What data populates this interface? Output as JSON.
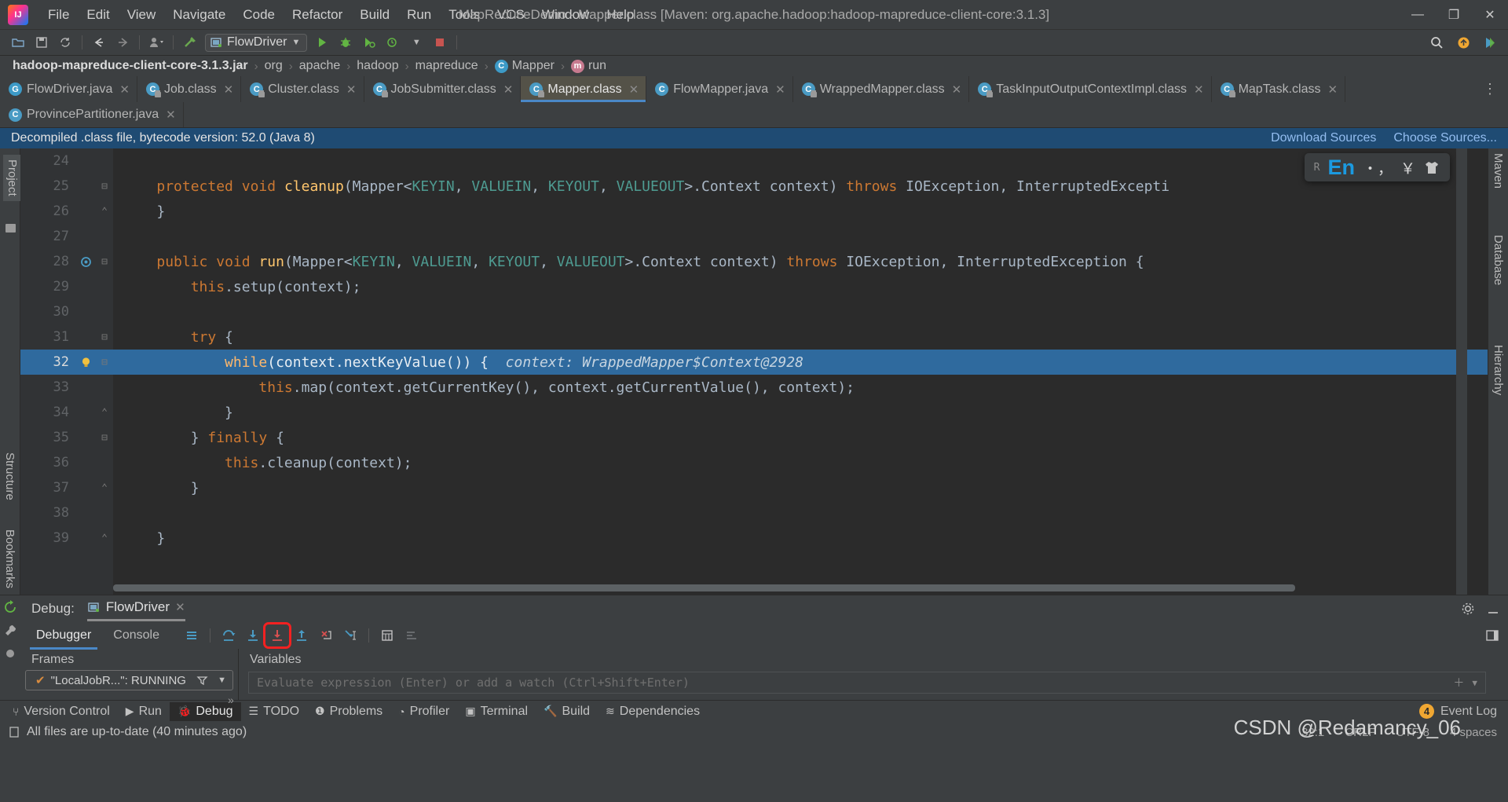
{
  "window": {
    "title": "MapReduceDemo - Mapper.class [Maven: org.apache.hadoop:hadoop-mapreduce-client-core:3.1.3]",
    "minimize": "—",
    "maximize": "❐",
    "close": "✕"
  },
  "menu": [
    "File",
    "Edit",
    "View",
    "Navigate",
    "Code",
    "Refactor",
    "Build",
    "Run",
    "Tools",
    "VCS",
    "Window",
    "Help"
  ],
  "toolbar": {
    "run_config": "FlowDriver",
    "icons": [
      "open-folder-icon",
      "save-icon",
      "sync-icon",
      "back-arrow-icon",
      "forward-arrow-icon",
      "profile-icon",
      "build-hammer-icon"
    ],
    "right_icons": [
      "search-icon",
      "account-icon",
      "updates-icon"
    ]
  },
  "breadcrumb": [
    {
      "label": "hadoop-mapreduce-client-core-3.1.3.jar",
      "icon": ""
    },
    {
      "label": "org",
      "icon": ""
    },
    {
      "label": "apache",
      "icon": ""
    },
    {
      "label": "hadoop",
      "icon": ""
    },
    {
      "label": "mapreduce",
      "icon": ""
    },
    {
      "label": "Mapper",
      "icon": "class-icon"
    },
    {
      "label": "run",
      "icon": "method-icon"
    }
  ],
  "tabs": [
    {
      "label": "FlowDriver.java",
      "icon": "java-run-icon",
      "active": false
    },
    {
      "label": "Job.class",
      "icon": "class-locked-icon",
      "active": false
    },
    {
      "label": "Cluster.class",
      "icon": "class-locked-icon",
      "active": false
    },
    {
      "label": "JobSubmitter.class",
      "icon": "class-locked-icon",
      "active": false
    },
    {
      "label": "Mapper.class",
      "icon": "class-locked-icon",
      "active": true
    },
    {
      "label": "FlowMapper.java",
      "icon": "class-icon",
      "active": false
    },
    {
      "label": "WrappedMapper.class",
      "icon": "class-locked-icon",
      "active": false
    },
    {
      "label": "TaskInputOutputContextImpl.class",
      "icon": "class-locked-icon",
      "active": false
    },
    {
      "label": "MapTask.class",
      "icon": "class-locked-icon",
      "active": false
    }
  ],
  "tabs_row2": [
    {
      "label": "ProvincePartitioner.java",
      "icon": "class-icon",
      "active": false
    }
  ],
  "notice": {
    "text": "Decompiled .class file, bytecode version: 52.0 (Java 8)",
    "download_sources": "Download Sources",
    "choose_sources": "Choose Sources..."
  },
  "ime": {
    "lang": "En",
    "punct": "・，",
    "currency": "￥",
    "shirt": "shirt-icon"
  },
  "sidebar_left": [
    "Project",
    "Structure",
    "Bookmarks"
  ],
  "sidebar_right": [
    "Maven",
    "Database",
    "Hierarchy"
  ],
  "code": {
    "lines": [
      {
        "num": "24",
        "fold": "",
        "bulb": false,
        "hl": false,
        "tokens": []
      },
      {
        "num": "25",
        "fold": "minus",
        "bulb": false,
        "hl": false,
        "tokens": [
          {
            "t": "    ",
            "c": "pn"
          },
          {
            "t": "protected",
            "c": "kw"
          },
          {
            "t": " ",
            "c": "pn"
          },
          {
            "t": "void",
            "c": "kw"
          },
          {
            "t": " ",
            "c": "pn"
          },
          {
            "t": "cleanup",
            "c": "fn"
          },
          {
            "t": "(Mapper<",
            "c": "pn"
          },
          {
            "t": "KEYIN",
            "c": "ty"
          },
          {
            "t": ", ",
            "c": "pn"
          },
          {
            "t": "VALUEIN",
            "c": "ty"
          },
          {
            "t": ", ",
            "c": "pn"
          },
          {
            "t": "KEYOUT",
            "c": "ty"
          },
          {
            "t": ", ",
            "c": "pn"
          },
          {
            "t": "VALUEOUT",
            "c": "ty"
          },
          {
            "t": ">.Context context) ",
            "c": "pn"
          },
          {
            "t": "throws",
            "c": "kw"
          },
          {
            "t": " IOException, InterruptedExcepti",
            "c": "pn"
          }
        ]
      },
      {
        "num": "26",
        "fold": "plus",
        "bulb": false,
        "hl": false,
        "tokens": [
          {
            "t": "    }",
            "c": "pn"
          }
        ]
      },
      {
        "num": "27",
        "fold": "",
        "bulb": false,
        "hl": false,
        "tokens": []
      },
      {
        "num": "28",
        "fold": "minus",
        "bulb": false,
        "hl": false,
        "mark": true,
        "tokens": [
          {
            "t": "    ",
            "c": "pn"
          },
          {
            "t": "public",
            "c": "kw"
          },
          {
            "t": " ",
            "c": "pn"
          },
          {
            "t": "void",
            "c": "kw"
          },
          {
            "t": " ",
            "c": "pn"
          },
          {
            "t": "run",
            "c": "fn"
          },
          {
            "t": "(Mapper<",
            "c": "pn"
          },
          {
            "t": "KEYIN",
            "c": "ty"
          },
          {
            "t": ", ",
            "c": "pn"
          },
          {
            "t": "VALUEIN",
            "c": "ty"
          },
          {
            "t": ", ",
            "c": "pn"
          },
          {
            "t": "KEYOUT",
            "c": "ty"
          },
          {
            "t": ", ",
            "c": "pn"
          },
          {
            "t": "VALUEOUT",
            "c": "ty"
          },
          {
            "t": ">.Context context) ",
            "c": "pn"
          },
          {
            "t": "throws",
            "c": "kw"
          },
          {
            "t": " IOException, InterruptedException {",
            "c": "pn"
          }
        ]
      },
      {
        "num": "29",
        "fold": "",
        "bulb": false,
        "hl": false,
        "tokens": [
          {
            "t": "        ",
            "c": "pn"
          },
          {
            "t": "this",
            "c": "kw"
          },
          {
            "t": ".setup(context);",
            "c": "pn"
          }
        ]
      },
      {
        "num": "30",
        "fold": "",
        "bulb": false,
        "hl": false,
        "tokens": []
      },
      {
        "num": "31",
        "fold": "minus",
        "bulb": false,
        "hl": false,
        "tokens": [
          {
            "t": "        ",
            "c": "pn"
          },
          {
            "t": "try",
            "c": "kw"
          },
          {
            "t": " {",
            "c": "pn"
          }
        ]
      },
      {
        "num": "32",
        "fold": "minus",
        "bulb": true,
        "hl": true,
        "tokens": [
          {
            "t": "            ",
            "c": "pn"
          },
          {
            "t": "while",
            "c": "kw"
          },
          {
            "t": "(context.nextKeyValue()) {",
            "c": "pn"
          },
          {
            "t": "  context: WrappedMapper$Context@2928",
            "c": "hint"
          }
        ]
      },
      {
        "num": "33",
        "fold": "",
        "bulb": false,
        "hl": false,
        "tokens": [
          {
            "t": "                ",
            "c": "pn"
          },
          {
            "t": "this",
            "c": "kw"
          },
          {
            "t": ".map(context.getCurrentKey(), context.getCurrentValue(), context);",
            "c": "pn"
          }
        ]
      },
      {
        "num": "34",
        "fold": "plus",
        "bulb": false,
        "hl": false,
        "tokens": [
          {
            "t": "            }",
            "c": "pn"
          }
        ]
      },
      {
        "num": "35",
        "fold": "minus",
        "bulb": false,
        "hl": false,
        "tokens": [
          {
            "t": "        } ",
            "c": "pn"
          },
          {
            "t": "finally",
            "c": "kw"
          },
          {
            "t": " {",
            "c": "pn"
          }
        ]
      },
      {
        "num": "36",
        "fold": "",
        "bulb": false,
        "hl": false,
        "tokens": [
          {
            "t": "            ",
            "c": "pn"
          },
          {
            "t": "this",
            "c": "kw"
          },
          {
            "t": ".cleanup(context);",
            "c": "pn"
          }
        ]
      },
      {
        "num": "37",
        "fold": "plus",
        "bulb": false,
        "hl": false,
        "tokens": [
          {
            "t": "        }",
            "c": "pn"
          }
        ]
      },
      {
        "num": "38",
        "fold": "",
        "bulb": false,
        "hl": false,
        "tokens": []
      },
      {
        "num": "39",
        "fold": "plus",
        "bulb": false,
        "hl": false,
        "tokens": [
          {
            "t": "    }",
            "c": "pn"
          }
        ]
      }
    ]
  },
  "debug": {
    "label": "Debug:",
    "session_tab": "FlowDriver",
    "tabs": [
      {
        "label": "Debugger",
        "selected": true
      },
      {
        "label": "Console",
        "selected": false
      }
    ],
    "buttons": [
      {
        "name": "show-execution-point-icon",
        "marked": false
      },
      {
        "name": "step-over-icon",
        "marked": false
      },
      {
        "name": "step-into-icon",
        "marked": false
      },
      {
        "name": "force-step-into-icon",
        "marked": true
      },
      {
        "name": "step-out-icon",
        "marked": false
      },
      {
        "name": "drop-frame-icon",
        "marked": false
      },
      {
        "name": "run-to-cursor-icon",
        "marked": false
      },
      {
        "name": "evaluate-expression-icon",
        "marked": false
      },
      {
        "name": "mute-breakpoints-icon",
        "marked": false
      }
    ],
    "frames_header": "Frames",
    "frame_item": "\"LocalJobR...\": RUNNING",
    "variables_header": "Variables",
    "evaluate_placeholder": "Evaluate expression (Enter) or add a watch (Ctrl+Shift+Enter)"
  },
  "statusbar": {
    "items": [
      {
        "label": "Version Control",
        "icon": "branch-icon",
        "active": false
      },
      {
        "label": "Run",
        "icon": "play-icon",
        "active": false
      },
      {
        "label": "Debug",
        "icon": "bug-icon",
        "active": true
      },
      {
        "label": "TODO",
        "icon": "list-icon",
        "active": false
      },
      {
        "label": "Problems",
        "icon": "warning-icon",
        "active": false
      },
      {
        "label": "Profiler",
        "icon": "profiler-icon",
        "active": false
      },
      {
        "label": "Terminal",
        "icon": "terminal-icon",
        "active": false
      },
      {
        "label": "Build",
        "icon": "hammer-icon",
        "active": false
      },
      {
        "label": "Dependencies",
        "icon": "layers-icon",
        "active": false
      }
    ],
    "event_log": "Event Log",
    "event_count": "4",
    "message": "All files are up-to-date (40 minutes ago)",
    "caret": "32:1",
    "line_sep": "CRLF",
    "encoding": "UTF-8",
    "indent": "4 spaces",
    "watermark": "CSDN @Redamancy_06"
  },
  "colors": {
    "accent_blue": "#4a88c7",
    "highlight_line": "#2f6a9e",
    "notice_bg": "#1f4b73",
    "mark_red": "#f32121",
    "editor_bg": "#2b2b2b",
    "chrome_bg": "#3c3f41"
  }
}
